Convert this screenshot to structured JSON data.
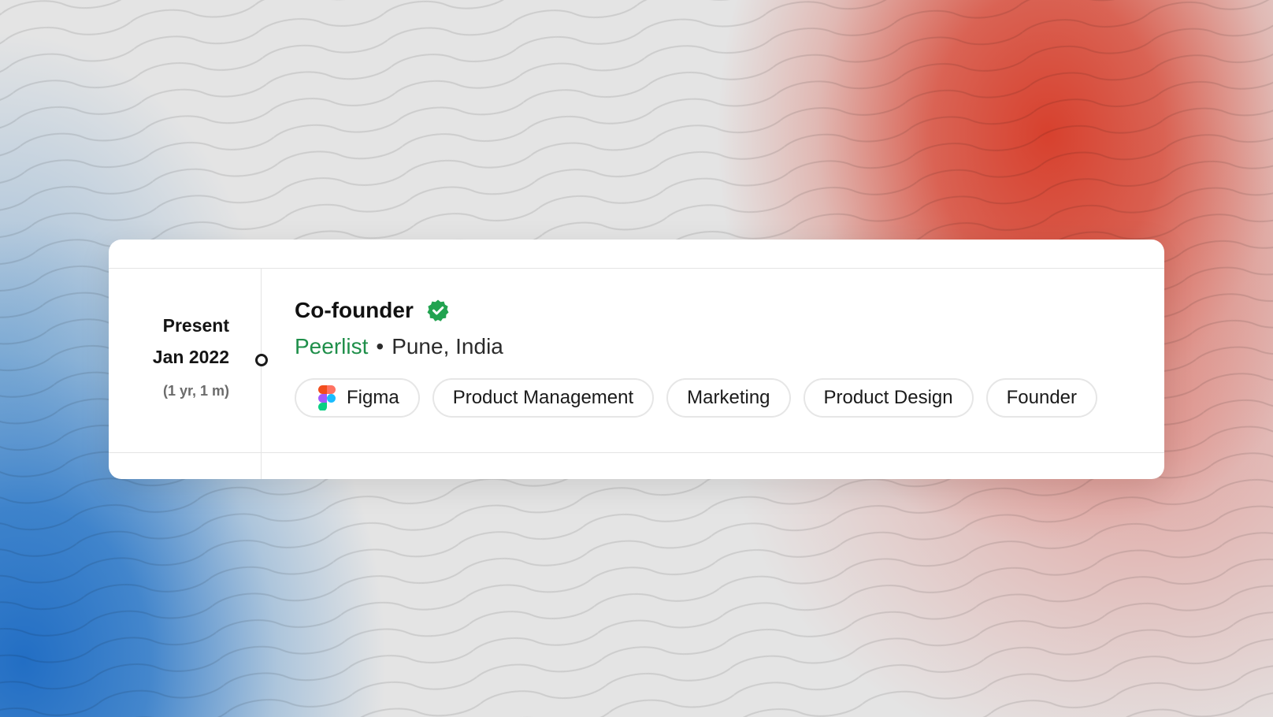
{
  "experience": {
    "end_label": "Present",
    "start_label": "Jan 2022",
    "duration": "(1 yr, 1 m)",
    "role": "Co-founder",
    "verified_icon": "verified-badge-icon",
    "company": "Peerlist",
    "separator": "•",
    "location": "Pune, India",
    "tags": [
      {
        "label": "Figma",
        "icon": "figma-icon"
      },
      {
        "label": "Product Management"
      },
      {
        "label": "Marketing"
      },
      {
        "label": "Product Design"
      },
      {
        "label": "Founder"
      }
    ]
  },
  "colors": {
    "company_green": "#1f8f4a",
    "verified_green": "#22a350",
    "background_red": "#d63824",
    "background_blue": "#226ec4"
  }
}
